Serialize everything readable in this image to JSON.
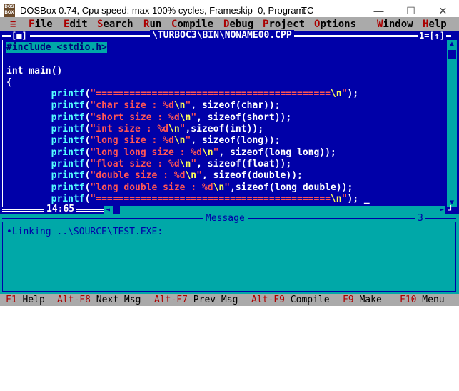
{
  "window": {
    "title": "DOSBox 0.74, Cpu speed: max 100% cycles, Frameskip  0, Program:",
    "program": "TC",
    "icon_text": "DOS BOX",
    "minimize_glyph": "—",
    "maximize_glyph": "☐",
    "close_glyph": "✕"
  },
  "menubar": {
    "system_glyph": "≡",
    "items": [
      {
        "hot": "F",
        "rest": "ile"
      },
      {
        "hot": "E",
        "rest": "dit"
      },
      {
        "hot": "S",
        "rest": "earch"
      },
      {
        "hot": "R",
        "rest": "un"
      },
      {
        "hot": "C",
        "rest": "ompile"
      },
      {
        "hot": "D",
        "rest": "ebug"
      },
      {
        "hot": "P",
        "rest": "roject"
      },
      {
        "hot": "O",
        "rest": "ptions"
      },
      {
        "hot": "W",
        "rest": "indow"
      },
      {
        "hot": "H",
        "rest": "elp"
      }
    ]
  },
  "editor": {
    "close_box": "[■]",
    "file_path": "\\TURBOC3\\BIN\\NONAME00.CPP",
    "window_number": "1=[↑]",
    "cursor_position": "14:65",
    "code_lines": [
      [
        {
          "t": "#include <stdio.h>",
          "c": "hl"
        }
      ],
      [],
      [
        {
          "t": "int main()",
          "c": "pl"
        }
      ],
      [
        {
          "t": "{",
          "c": "pl"
        }
      ],
      [
        {
          "t": "        ",
          "c": "pl"
        },
        {
          "t": "printf",
          "c": "fn"
        },
        {
          "t": "(",
          "c": "pl"
        },
        {
          "t": "\"==========================================",
          "c": "str"
        },
        {
          "t": "\\n",
          "c": "esc"
        },
        {
          "t": "\"",
          "c": "str"
        },
        {
          "t": ");",
          "c": "pl"
        }
      ],
      [
        {
          "t": "        ",
          "c": "pl"
        },
        {
          "t": "printf",
          "c": "fn"
        },
        {
          "t": "(",
          "c": "pl"
        },
        {
          "t": "\"char size : %d",
          "c": "str"
        },
        {
          "t": "\\n",
          "c": "esc"
        },
        {
          "t": "\"",
          "c": "str"
        },
        {
          "t": ", sizeof(char));",
          "c": "pl"
        }
      ],
      [
        {
          "t": "        ",
          "c": "pl"
        },
        {
          "t": "printf",
          "c": "fn"
        },
        {
          "t": "(",
          "c": "pl"
        },
        {
          "t": "\"short size : %d",
          "c": "str"
        },
        {
          "t": "\\n",
          "c": "esc"
        },
        {
          "t": "\"",
          "c": "str"
        },
        {
          "t": ", sizeof(short));",
          "c": "pl"
        }
      ],
      [
        {
          "t": "        ",
          "c": "pl"
        },
        {
          "t": "printf",
          "c": "fn"
        },
        {
          "t": "(",
          "c": "pl"
        },
        {
          "t": "\"int size : %d",
          "c": "str"
        },
        {
          "t": "\\n",
          "c": "esc"
        },
        {
          "t": "\"",
          "c": "str"
        },
        {
          "t": ",sizeof(int));",
          "c": "pl"
        }
      ],
      [
        {
          "t": "        ",
          "c": "pl"
        },
        {
          "t": "printf",
          "c": "fn"
        },
        {
          "t": "(",
          "c": "pl"
        },
        {
          "t": "\"long size : %d",
          "c": "str"
        },
        {
          "t": "\\n",
          "c": "esc"
        },
        {
          "t": "\"",
          "c": "str"
        },
        {
          "t": ", sizeof(long));",
          "c": "pl"
        }
      ],
      [
        {
          "t": "        ",
          "c": "pl"
        },
        {
          "t": "printf",
          "c": "fn"
        },
        {
          "t": "(",
          "c": "pl"
        },
        {
          "t": "\"long long size : %d",
          "c": "str"
        },
        {
          "t": "\\n",
          "c": "esc"
        },
        {
          "t": "\"",
          "c": "str"
        },
        {
          "t": ", sizeof(long long));",
          "c": "pl"
        }
      ],
      [
        {
          "t": "        ",
          "c": "pl"
        },
        {
          "t": "printf",
          "c": "fn"
        },
        {
          "t": "(",
          "c": "pl"
        },
        {
          "t": "\"float size : %d",
          "c": "str"
        },
        {
          "t": "\\n",
          "c": "esc"
        },
        {
          "t": "\"",
          "c": "str"
        },
        {
          "t": ", sizeof(float));",
          "c": "pl"
        }
      ],
      [
        {
          "t": "        ",
          "c": "pl"
        },
        {
          "t": "printf",
          "c": "fn"
        },
        {
          "t": "(",
          "c": "pl"
        },
        {
          "t": "\"double size : %d",
          "c": "str"
        },
        {
          "t": "\\n",
          "c": "esc"
        },
        {
          "t": "\"",
          "c": "str"
        },
        {
          "t": ", sizeof(double));",
          "c": "pl"
        }
      ],
      [
        {
          "t": "        ",
          "c": "pl"
        },
        {
          "t": "printf",
          "c": "fn"
        },
        {
          "t": "(",
          "c": "pl"
        },
        {
          "t": "\"long double size : %d",
          "c": "str"
        },
        {
          "t": "\\n",
          "c": "esc"
        },
        {
          "t": "\"",
          "c": "str"
        },
        {
          "t": ",sizeof(long double));",
          "c": "pl"
        }
      ],
      [
        {
          "t": "        ",
          "c": "pl"
        },
        {
          "t": "printf",
          "c": "fn"
        },
        {
          "t": "(",
          "c": "pl"
        },
        {
          "t": "\"==========================================",
          "c": "str"
        },
        {
          "t": "\\n",
          "c": "esc"
        },
        {
          "t": "\"",
          "c": "str"
        },
        {
          "t": ");",
          "c": "pl"
        },
        {
          "t": " _",
          "c": "cursor"
        }
      ]
    ]
  },
  "message_window": {
    "title": "Message",
    "number": "3",
    "text": "•Linking ..\\SOURCE\\TEST.EXE:"
  },
  "statusbar": {
    "items": [
      {
        "key": "F1",
        "label": " Help"
      },
      {
        "key": "Alt-F8",
        "label": " Next Msg"
      },
      {
        "key": "Alt-F7",
        "label": " Prev Msg"
      },
      {
        "key": "Alt-F9",
        "label": " Compile"
      },
      {
        "key": "F9",
        "label": " Make"
      },
      {
        "key": "F10",
        "label": " Menu"
      }
    ]
  },
  "colors": {
    "editor_bg": "#0000a8",
    "menu_bg": "#aaaaaa",
    "message_bg": "#00a8a8",
    "hotkey": "#aa0000"
  }
}
